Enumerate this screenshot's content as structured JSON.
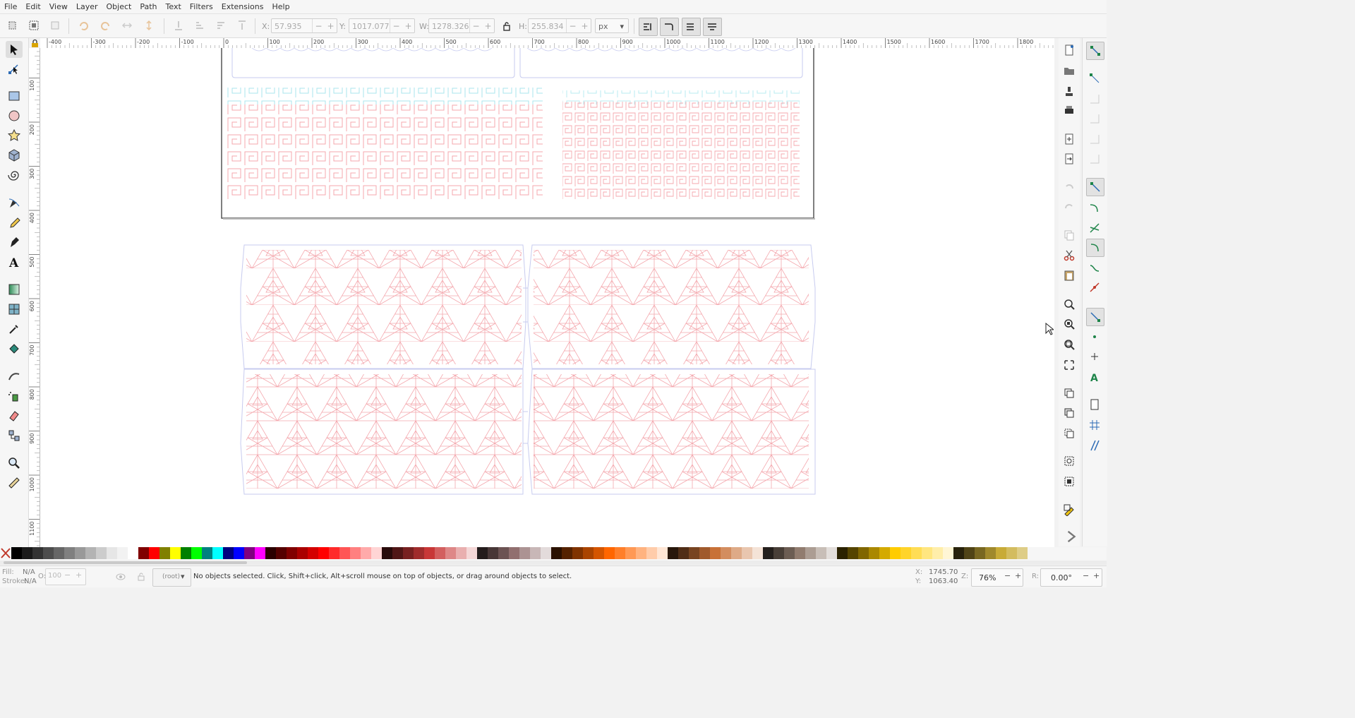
{
  "menu": [
    "File",
    "Edit",
    "View",
    "Layer",
    "Object",
    "Path",
    "Text",
    "Filters",
    "Extensions",
    "Help"
  ],
  "toolbar": {
    "x_label": "X:",
    "x_value": "57.935",
    "y_label": "Y:",
    "y_value": "1017.077",
    "w_label": "W:",
    "w_value": "1278.326",
    "h_label": "H:",
    "h_value": "255.834",
    "unit": "px",
    "minus": "−",
    "plus": "+"
  },
  "tools": [
    "selector-tool",
    "node-tool",
    "rectangle-tool",
    "ellipse-tool",
    "star-tool",
    "3dbox-tool",
    "spiral-tool",
    "pen-tool",
    "pencil-tool",
    "calligraphy-tool",
    "text-tool",
    "gradient-tool",
    "mesh-tool",
    "dropper-tool",
    "paint-bucket-tool",
    "tweak-tool",
    "spray-tool",
    "eraser-tool",
    "connector-tool",
    "zoom-tool",
    "measure-tool"
  ],
  "ruler": {
    "h_labels": [
      "-400",
      "-300",
      "-200",
      "-100",
      "0",
      "100",
      "200",
      "300",
      "400",
      "500",
      "600",
      "700",
      "800",
      "900",
      "1000",
      "1100",
      "1200",
      "1300",
      "1400",
      "1500",
      "1600",
      "1700",
      "1800"
    ],
    "v_labels": [
      "0",
      "100",
      "200",
      "300",
      "400",
      "500",
      "600",
      "700",
      "800",
      "900",
      "1000",
      "1100",
      "1200"
    ]
  },
  "colors": {
    "accent_pattern": "#f4a7ad",
    "cyan_pattern": "#a8e6ec",
    "blue_outline": "#c7cbef",
    "page_border": "#555555",
    "palette": [
      "#000000",
      "#1a1a1a",
      "#333333",
      "#4d4d4d",
      "#666666",
      "#808080",
      "#999999",
      "#b3b3b3",
      "#cccccc",
      "#e6e6e6",
      "#f2f2f2",
      "#ffffff",
      "#800000",
      "#ff0000",
      "#808000",
      "#ffff00",
      "#008000",
      "#00ff00",
      "#008080",
      "#00ffff",
      "#000080",
      "#0000ff",
      "#800080",
      "#ff00ff",
      "#2b0000",
      "#550000",
      "#800000",
      "#aa0000",
      "#d40000",
      "#ff0000",
      "#ff2a2a",
      "#ff5555",
      "#ff8080",
      "#ffaaaa",
      "#ffd5d5",
      "#280b0b",
      "#501616",
      "#782121",
      "#a02c2c",
      "#c83737",
      "#d35f5f",
      "#de8787",
      "#e9afaf",
      "#f4d7d7",
      "#241c1c",
      "#483737",
      "#6c5353",
      "#916f6f",
      "#ac9393",
      "#c8b7b7",
      "#e3dbdb",
      "#2b1100",
      "#552200",
      "#803300",
      "#aa4400",
      "#d45500",
      "#ff6600",
      "#ff7f2a",
      "#ff9955",
      "#ffb380",
      "#ffccaa",
      "#ffe6d5",
      "#28170b",
      "#502d16",
      "#784421",
      "#a05a2c",
      "#c87137",
      "#d38d5f",
      "#deaa87",
      "#e9c6af",
      "#f4e3d7",
      "#241f1c",
      "#483e37",
      "#6c5d53",
      "#917c6f",
      "#ac9d93",
      "#c8beb7",
      "#e3dedb",
      "#2b2200",
      "#554400",
      "#806600",
      "#aa8800",
      "#d4aa00",
      "#ffcc00",
      "#ffd42a",
      "#ffdd55",
      "#ffe680",
      "#ffeeaa",
      "#fff6d5",
      "#28220b",
      "#504416",
      "#786721",
      "#a0892c",
      "#c8ab37",
      "#d3bc5f",
      "#decd87"
    ]
  },
  "status": {
    "fill_label": "Fill:",
    "fill_value": "N/A",
    "stroke_label": "Stroke:",
    "stroke_value": "N/A",
    "opacity_label": "O:",
    "opacity_value": "100",
    "layer": "(root)",
    "message": "No objects selected. Click, Shift+click, Alt+scroll mouse on top of objects, or drag around objects to select.",
    "cursor_x_label": "X:",
    "cursor_x": "1745.70",
    "cursor_y_label": "Y:",
    "cursor_y": "1063.40",
    "zoom_label": "Z:",
    "zoom": "76%",
    "rotation_label": "R:",
    "rotation": "0.00°"
  }
}
